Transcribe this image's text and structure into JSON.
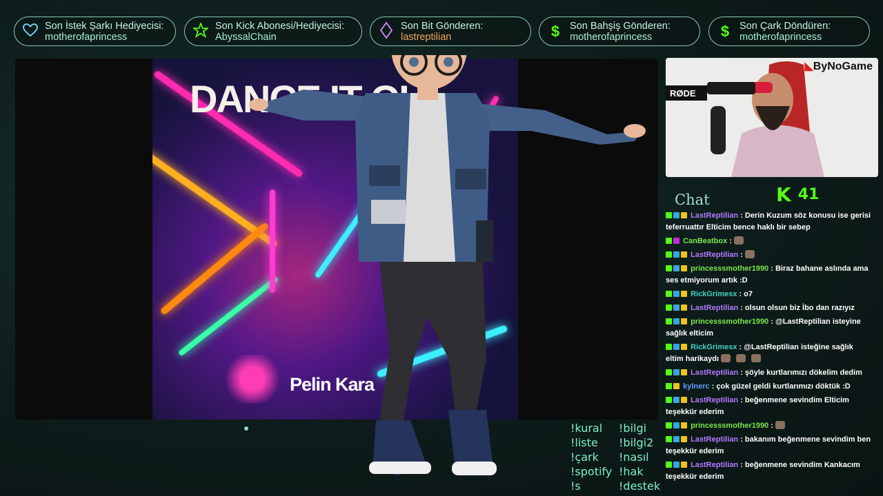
{
  "topbar": {
    "badges": [
      {
        "icon": "heart-icon",
        "label": "Son İstek Şarkı Hediyecisi:",
        "value": "motherofaprincess"
      },
      {
        "icon": "star-icon",
        "label": "Son Kick Abonesi/Hediyecisi:",
        "value": "AbyssalChain"
      },
      {
        "icon": "diamond-icon",
        "label": "Son Bit Gönderen:",
        "value": "lastreptilian"
      },
      {
        "icon": "dollar-icon",
        "label": "Son Bahşiş Gönderen:",
        "value": "motherofaprincess"
      },
      {
        "icon": "dollar-icon",
        "label": "Son Çark Döndüren:",
        "value": "motherofaprincess"
      }
    ]
  },
  "media": {
    "album_title": "DANCE IT OU",
    "album_artist": "Pelin Kara"
  },
  "commands": [
    "!kural",
    "!bilgi",
    "!liste",
    "!bilgi2",
    "!çark",
    "!nasıl",
    "!spotify",
    "!hak",
    "!s",
    "!destek"
  ],
  "camera": {
    "brand_logo": "ByNoGame",
    "mic_brand": "RØDE"
  },
  "chat": {
    "heading": "Chat",
    "viewer_count": "41",
    "viewer_icon": "kick-icon",
    "messages": [
      {
        "user": "LastReptilian",
        "color": "purple",
        "text": ": Derin Kuzum söz konusu ise gerisi teferruattır Elticim bence haklı bir sebep"
      },
      {
        "user": "CanBeatbox",
        "color": "green",
        "text": ":"
      },
      {
        "user": "LastReptilian",
        "color": "purple",
        "text": ":"
      },
      {
        "user": "princesssmother1990",
        "color": "green",
        "text": ": Biraz bahane aslında ama ses etmiyorum artık :D"
      },
      {
        "user": "RickGrimesx",
        "color": "teal",
        "text": ": o7"
      },
      {
        "user": "LastReptilian",
        "color": "purple",
        "text": ": olsun olsun biz İbo dan razıyız"
      },
      {
        "user": "princesssmother1990",
        "color": "green",
        "text": ": @LastReptilian isteyine sağlık elticim"
      },
      {
        "user": "RickGrimesx",
        "color": "teal",
        "text": ": @LastReptilian isteğine sağlık eltim harikaydı"
      },
      {
        "user": "LastReptilian",
        "color": "purple",
        "text": ": şöyle kurtlarımızı dökelim dedim"
      },
      {
        "user": "kylnerc",
        "color": "blue",
        "text": ": çok güzel geldi kurtlarımızı döktük :D"
      },
      {
        "user": "LastReptilian",
        "color": "purple",
        "text": ": beğenmene sevindim Elticim teşekkür ederim"
      },
      {
        "user": "princesssmother1990",
        "color": "green",
        "text": ":"
      },
      {
        "user": "LastReptilian",
        "color": "purple",
        "text": ": bakanım beğenmene sevindim ben teşekkür ederim"
      },
      {
        "user": "LastReptilian",
        "color": "purple",
        "text": ": beğenmene sevindim Kankacım teşekkür ederim"
      }
    ]
  }
}
